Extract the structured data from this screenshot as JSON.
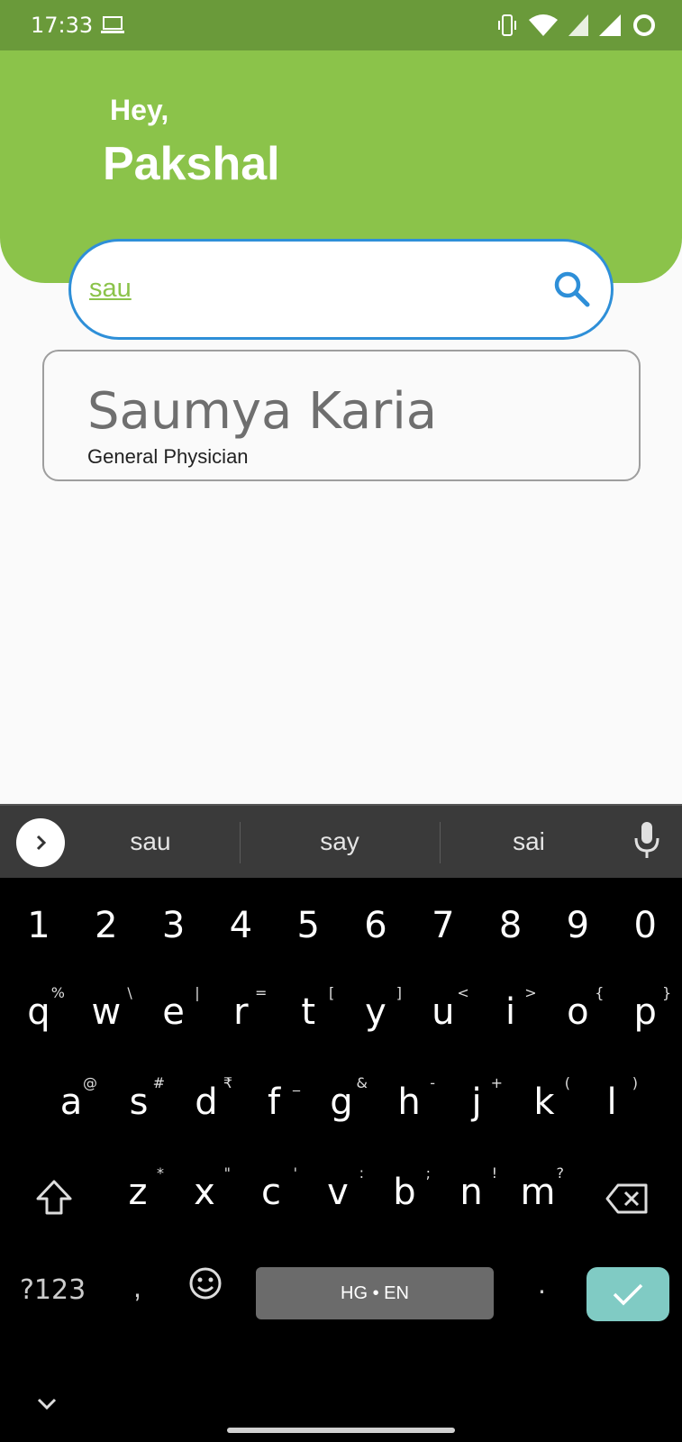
{
  "status_bar": {
    "time": "17:33",
    "icons": [
      "laptop-icon",
      "vibrate-icon",
      "wifi-icon",
      "signal-icon",
      "signal-icon",
      "battery-ring-icon"
    ]
  },
  "header": {
    "greeting": "Hey,",
    "username": "Pakshal",
    "color": "#8bc34a"
  },
  "search": {
    "value": "sau",
    "icon": "search-icon",
    "accent": "#2e8fd8"
  },
  "results": [
    {
      "name": "Saumya Karia",
      "specialty": "General Physician"
    }
  ],
  "keyboard": {
    "suggestions": [
      "sau",
      "say",
      "sai"
    ],
    "number_row": [
      "1",
      "2",
      "3",
      "4",
      "5",
      "6",
      "7",
      "8",
      "9",
      "0"
    ],
    "row1": [
      {
        "key": "q",
        "alt": "%"
      },
      {
        "key": "w",
        "alt": "\\"
      },
      {
        "key": "e",
        "alt": "|"
      },
      {
        "key": "r",
        "alt": "="
      },
      {
        "key": "t",
        "alt": "["
      },
      {
        "key": "y",
        "alt": "]"
      },
      {
        "key": "u",
        "alt": "<"
      },
      {
        "key": "i",
        "alt": ">"
      },
      {
        "key": "o",
        "alt": "{"
      },
      {
        "key": "p",
        "alt": "}"
      }
    ],
    "row2": [
      {
        "key": "a",
        "alt": "@"
      },
      {
        "key": "s",
        "alt": "#"
      },
      {
        "key": "d",
        "alt": "₹"
      },
      {
        "key": "f",
        "alt": "_"
      },
      {
        "key": "g",
        "alt": "&"
      },
      {
        "key": "h",
        "alt": "-"
      },
      {
        "key": "j",
        "alt": "+"
      },
      {
        "key": "k",
        "alt": "("
      },
      {
        "key": "l",
        "alt": ")"
      }
    ],
    "row3": [
      {
        "key": "z",
        "alt": "*"
      },
      {
        "key": "x",
        "alt": "\""
      },
      {
        "key": "c",
        "alt": "'"
      },
      {
        "key": "v",
        "alt": ":"
      },
      {
        "key": "b",
        "alt": ";"
      },
      {
        "key": "n",
        "alt": "!"
      },
      {
        "key": "m",
        "alt": "?"
      }
    ],
    "symbols_label": "?123",
    "comma": ",",
    "space_label": "HG • EN",
    "period": ".",
    "enter_color": "#80cbc4"
  }
}
